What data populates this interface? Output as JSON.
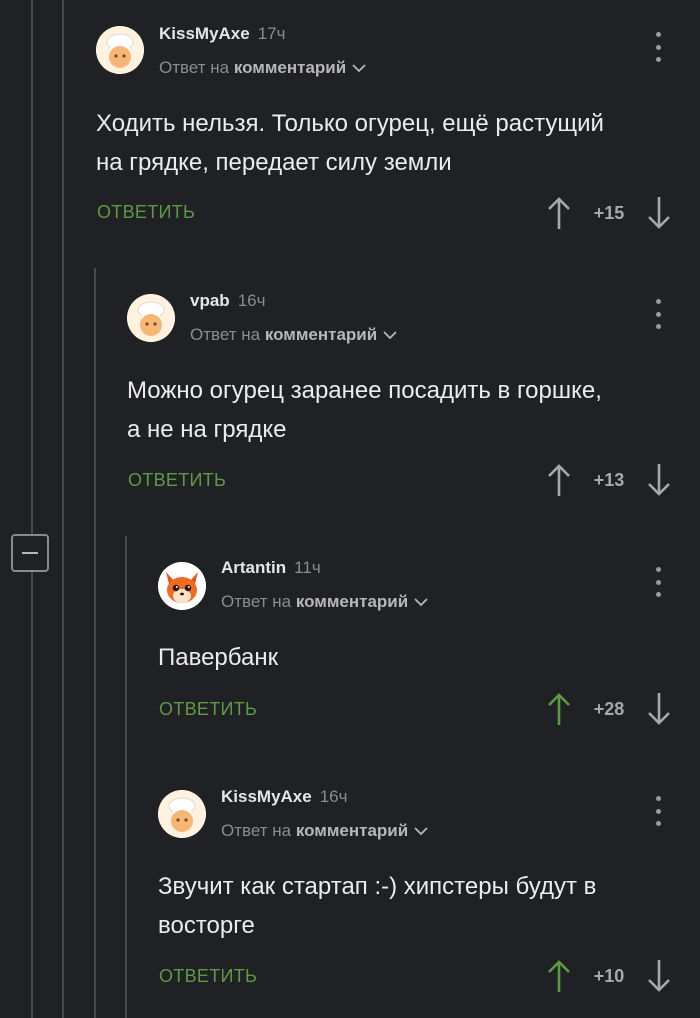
{
  "comments": [
    {
      "author": "KissMyAxe",
      "time": "17ч",
      "reply_prefix": "Ответ на",
      "reply_link": "комментарий",
      "text_lines": [
        "Ходить нельзя. Только огурец, ещё растущий",
        "на грядке, передает силу земли"
      ],
      "reply_label": "ОТВЕТИТЬ",
      "score": "+15",
      "upvoted": false,
      "avatar_icon": "chef-avatar-icon"
    },
    {
      "author": "vpab",
      "time": "16ч",
      "reply_prefix": "Ответ на",
      "reply_link": "комментарий",
      "text_lines": [
        "Можно огурец заранее посадить в горшке,",
        "а не на грядке"
      ],
      "reply_label": "ОТВЕТИТЬ",
      "score": "+13",
      "upvoted": false,
      "avatar_icon": "chef-avatar-icon"
    },
    {
      "author": "Artantin",
      "time": "11ч",
      "reply_prefix": "Ответ на",
      "reply_link": "комментарий",
      "text_lines": [
        "Павербанк"
      ],
      "reply_label": "ОТВЕТИТЬ",
      "score": "+28",
      "upvoted": true,
      "avatar_icon": "fox-avatar-icon"
    },
    {
      "author": "KissMyAxe",
      "time": "16ч",
      "reply_prefix": "Ответ на",
      "reply_link": "комментарий",
      "text_lines": [
        "Звучит как стартап :-) хипстеры будут в",
        "восторге"
      ],
      "reply_label": "ОТВЕТИТЬ",
      "score": "+10",
      "upvoted": true,
      "avatar_icon": "chef-avatar-icon"
    }
  ],
  "colors": {
    "background": "#202124",
    "reply_green": "#5e9a45",
    "upvote_active": "#5e9a45",
    "arrow_default": "#a8a8ab"
  }
}
